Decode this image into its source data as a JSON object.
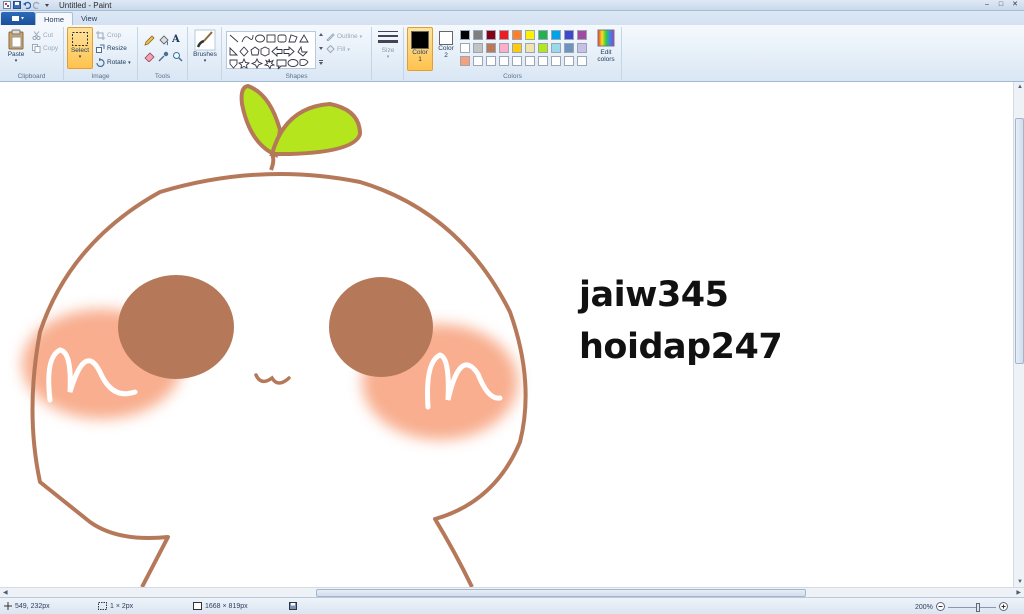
{
  "window": {
    "title": "Untitled - Paint"
  },
  "tabs": {
    "home": "Home",
    "view": "View"
  },
  "clipboard": {
    "paste": "Paste",
    "cut": "Cut",
    "copy": "Copy",
    "label": "Clipboard"
  },
  "image": {
    "select": "Select",
    "crop": "Crop",
    "resize": "Resize",
    "rotate": "Rotate",
    "label": "Image"
  },
  "tools": {
    "label": "Tools",
    "text_tool": "A"
  },
  "brushes": {
    "label": "Brushes"
  },
  "shapes": {
    "outline": "Outline",
    "fill": "Fill",
    "label": "Shapes"
  },
  "size": {
    "label": "Size"
  },
  "colors": {
    "color1_label": "Color",
    "color1_num": "1",
    "color2_label": "Color",
    "color2_num": "2",
    "edit_label": "Edit",
    "edit_label2": "colors",
    "label": "Colors",
    "color1": "#000000",
    "color2": "#ffffff",
    "palette_row1": [
      "#000000",
      "#7f7f7f",
      "#880015",
      "#ed1c24",
      "#ff7f27",
      "#fff200",
      "#22b14c",
      "#00a2e8",
      "#3f48cc",
      "#a349a4"
    ],
    "palette_row2": [
      "#ffffff",
      "#c3c3c3",
      "#b97a57",
      "#ffaec9",
      "#ffc90e",
      "#efe4b0",
      "#b5e61d",
      "#99d9ea",
      "#7092be",
      "#c8bfe7"
    ],
    "palette_row3": [
      "#f7a07c",
      "#ffffff",
      "#ffffff",
      "#ffffff",
      "#ffffff",
      "#ffffff",
      "#ffffff",
      "#ffffff",
      "#ffffff",
      "#ffffff"
    ]
  },
  "canvas": {
    "line1": "jaiw345",
    "line2": "hoidap247",
    "stroke": "#b5795a",
    "blush": "#f7a07c",
    "leaf": "#b5e61d"
  },
  "status": {
    "cursor": "549, 232px",
    "selection": "1 × 2px",
    "canvas_size": "1668 × 819px",
    "zoom": "200%"
  }
}
